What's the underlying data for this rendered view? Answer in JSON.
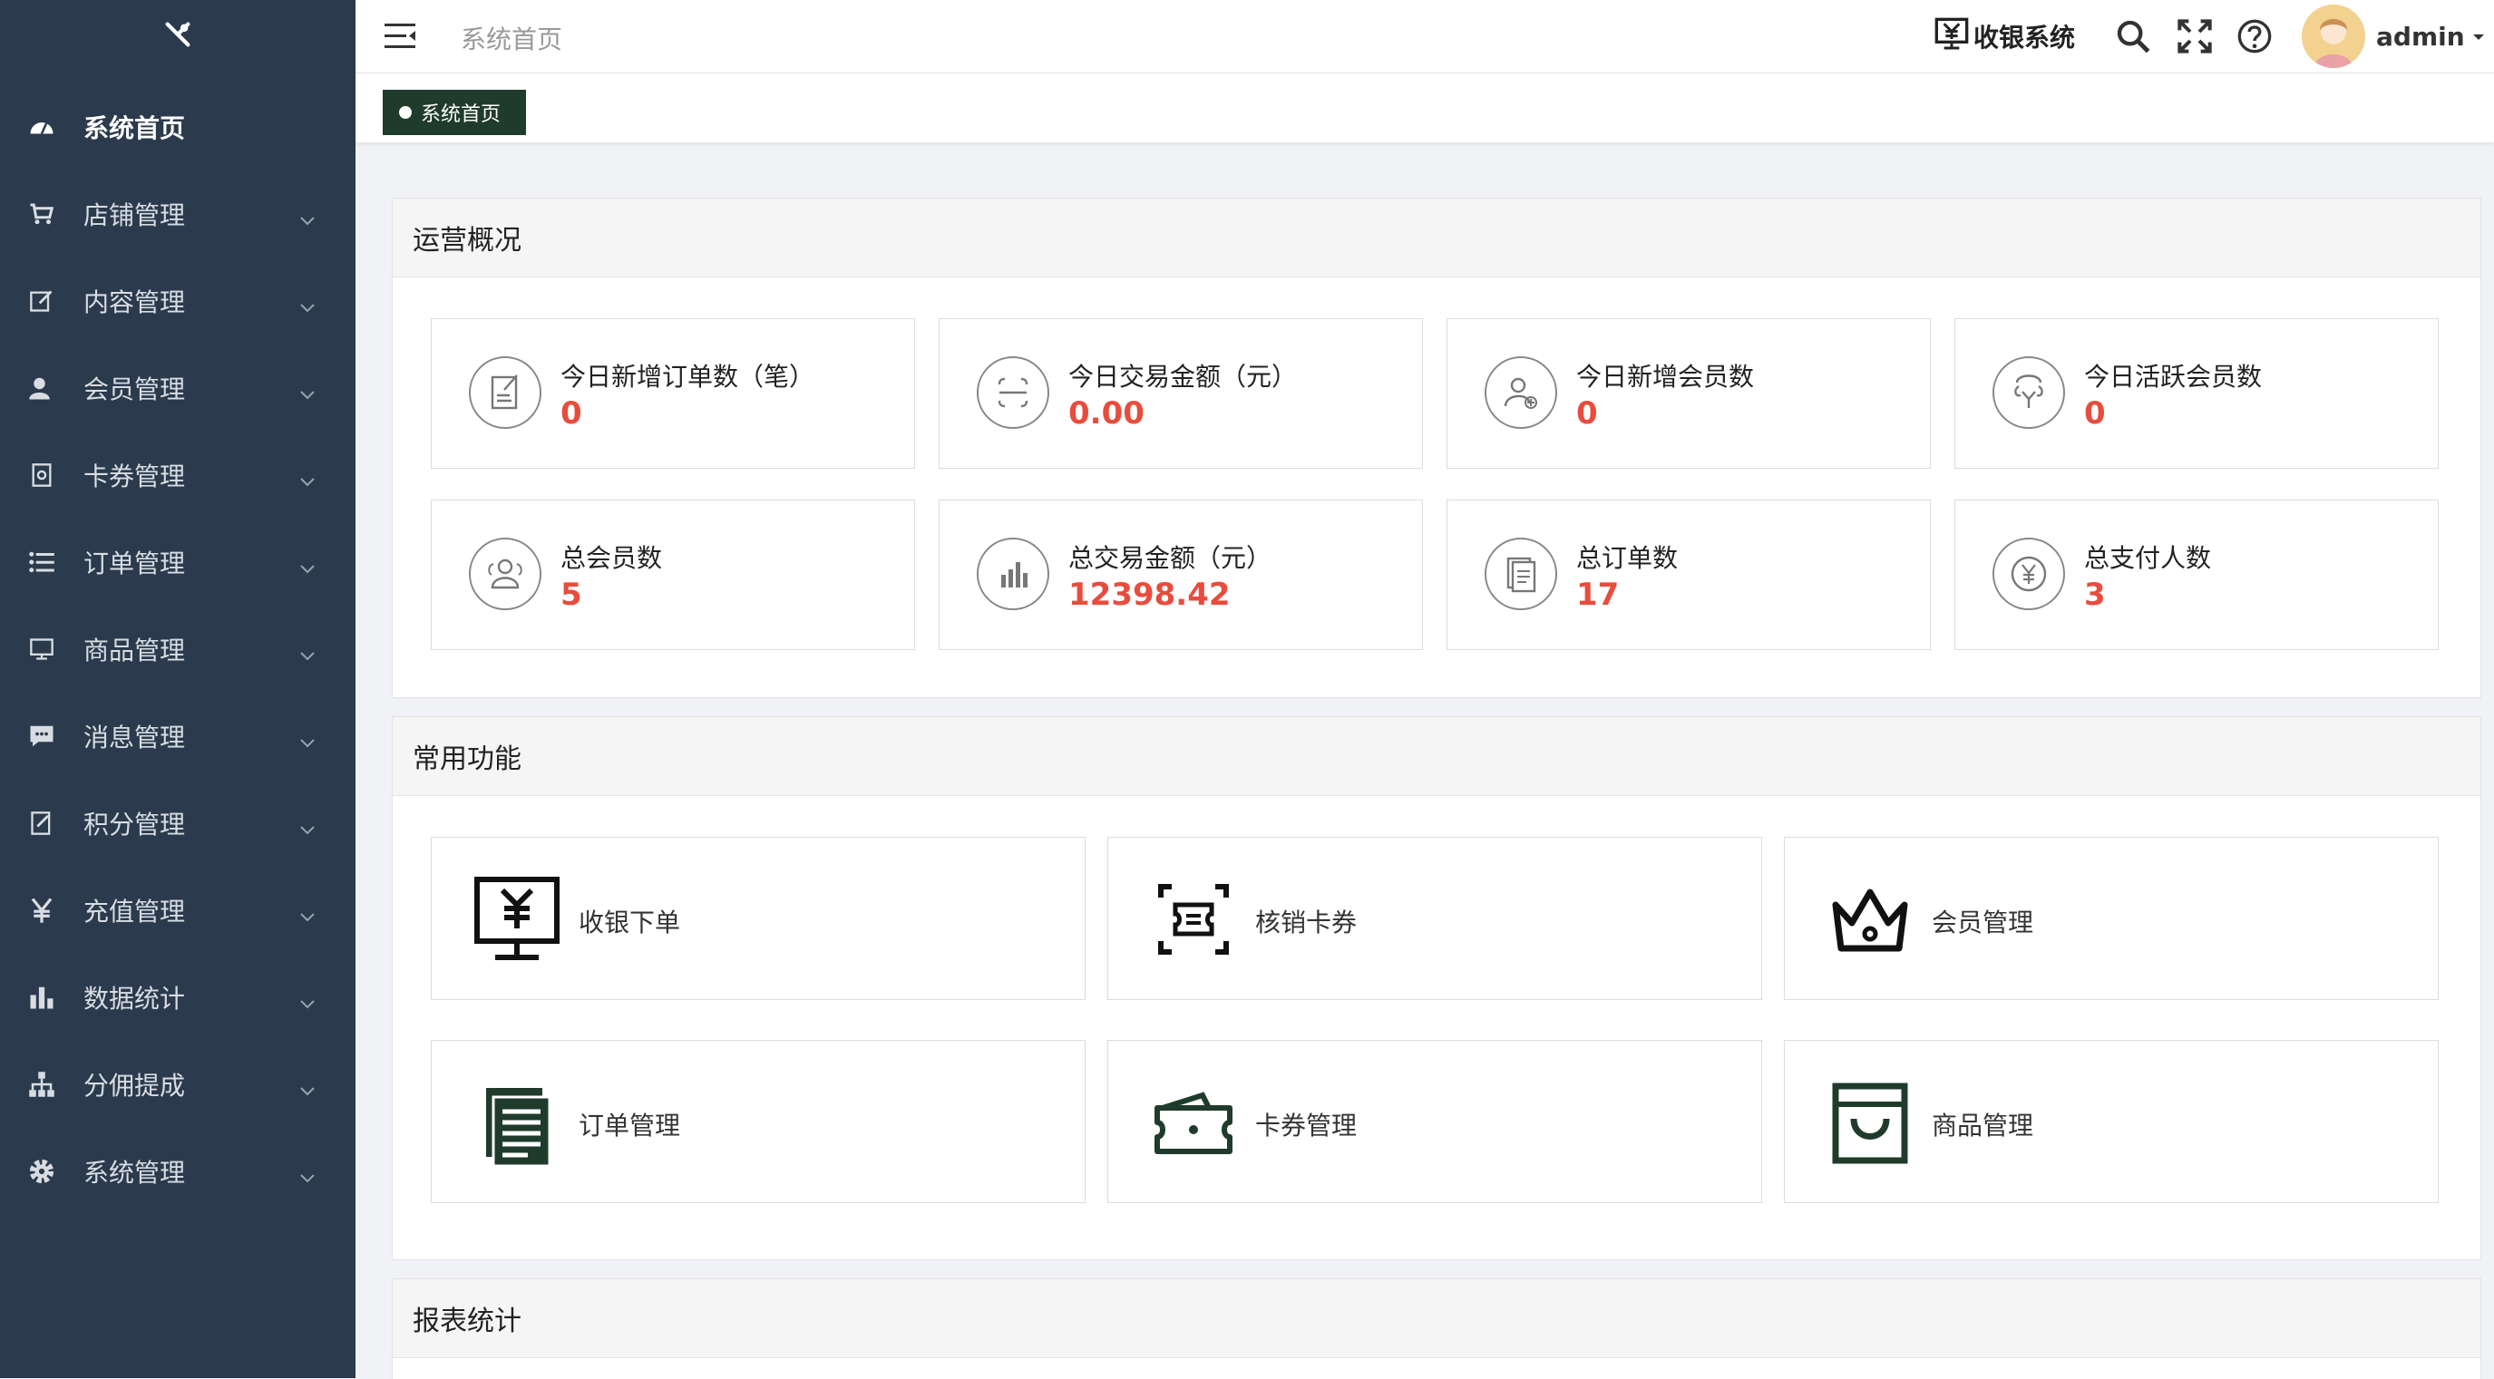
{
  "sidebar": {
    "items": [
      {
        "label": "系统首页",
        "icon": "dashboard-icon",
        "active": true
      },
      {
        "label": "店铺管理",
        "icon": "cart-icon"
      },
      {
        "label": "内容管理",
        "icon": "edit-icon"
      },
      {
        "label": "会员管理",
        "icon": "user-icon"
      },
      {
        "label": "卡券管理",
        "icon": "card-icon"
      },
      {
        "label": "订单管理",
        "icon": "list-icon"
      },
      {
        "label": "商品管理",
        "icon": "monitor-icon"
      },
      {
        "label": "消息管理",
        "icon": "message-icon"
      },
      {
        "label": "积分管理",
        "icon": "points-icon"
      },
      {
        "label": "充值管理",
        "icon": "yen-icon"
      },
      {
        "label": "数据统计",
        "icon": "bar-chart-icon"
      },
      {
        "label": "分佣提成",
        "icon": "sitemap-icon"
      },
      {
        "label": "系统管理",
        "icon": "gear-icon"
      }
    ]
  },
  "header": {
    "breadcrumb": "系统首页",
    "cashier_label": "收银系统",
    "username": "admin"
  },
  "tabs": {
    "active_label": "系统首页"
  },
  "overview": {
    "title": "运营概况",
    "stats": [
      {
        "label": "今日新增订单数（笔）",
        "value": "0",
        "icon": "order-edit-icon"
      },
      {
        "label": "今日交易金额（元）",
        "value": "0.00",
        "icon": "scan-icon"
      },
      {
        "label": "今日新增会员数",
        "value": "0",
        "icon": "add-user-icon"
      },
      {
        "label": "今日活跃会员数",
        "value": "0",
        "icon": "active-member-icon"
      },
      {
        "label": "总会员数",
        "value": "5",
        "icon": "members-icon"
      },
      {
        "label": "总交易金额（元）",
        "value": "12398.42",
        "icon": "bar-chart-icon"
      },
      {
        "label": "总订单数",
        "value": "17",
        "icon": "clipboard-icon"
      },
      {
        "label": "总支付人数",
        "value": "3",
        "icon": "yen-coin-icon"
      }
    ]
  },
  "functions": {
    "title": "常用功能",
    "items": [
      {
        "label": "收银下单",
        "icon": "cashier-icon"
      },
      {
        "label": "核销卡券",
        "icon": "ticket-scan-icon"
      },
      {
        "label": "会员管理",
        "icon": "crown-icon"
      },
      {
        "label": "订单管理",
        "icon": "document-icon"
      },
      {
        "label": "卡券管理",
        "icon": "wallet-icon"
      },
      {
        "label": "商品管理",
        "icon": "bag-icon"
      }
    ]
  },
  "reports": {
    "title": "报表统计"
  },
  "colors": {
    "sidebar_bg": "#2b3a4d",
    "accent_dark_green": "#1f3b2c",
    "value_red": "#e84c3d"
  }
}
